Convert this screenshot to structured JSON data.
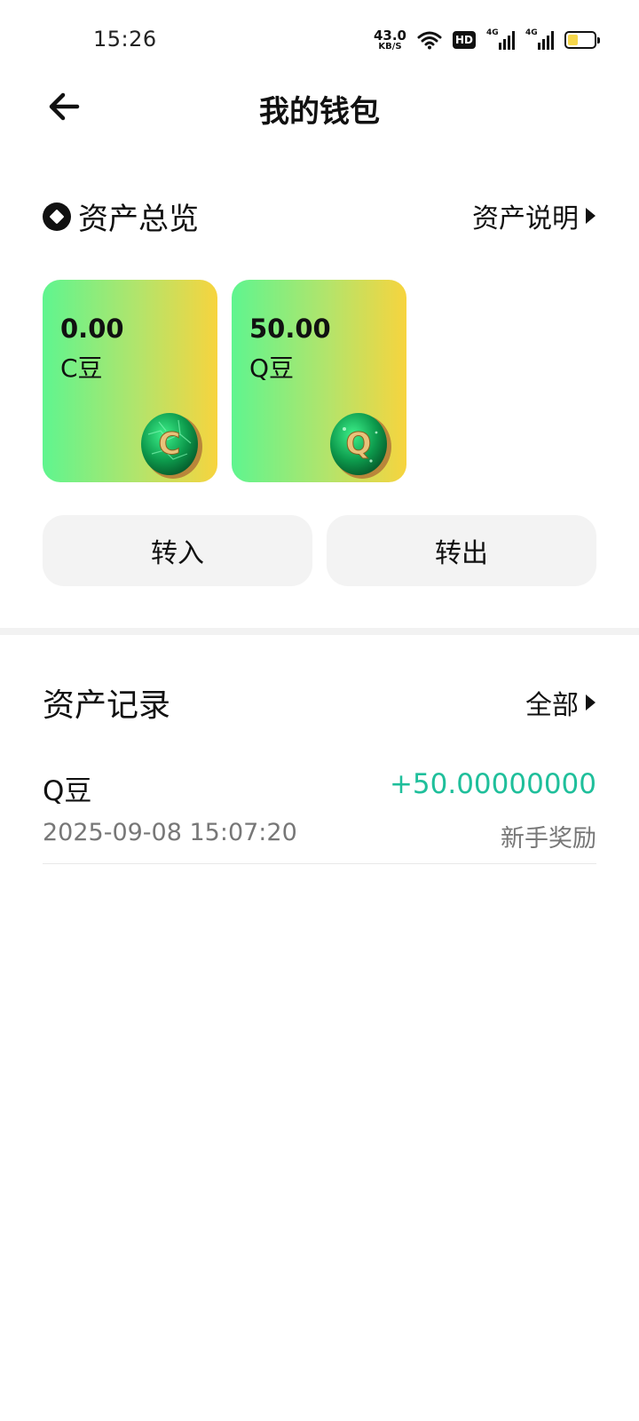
{
  "status_bar": {
    "time": "15:26",
    "net_speed_value": "43.0",
    "net_speed_unit": "KB/S",
    "hd_label": "HD",
    "sim1_tag": "4G",
    "sim2_tag": "4G",
    "battery_level": 0.38,
    "battery_color": "#f5d64a"
  },
  "header": {
    "title": "我的钱包",
    "back_icon": "arrow-left-icon"
  },
  "overview": {
    "title": "资产总览",
    "desc_link": "资产说明",
    "cards": [
      {
        "amount": "0.00",
        "name": "C豆",
        "coin_letter": "C"
      },
      {
        "amount": "50.00",
        "name": "Q豆",
        "coin_letter": "Q"
      }
    ]
  },
  "actions": {
    "transfer_in": "转入",
    "transfer_out": "转出"
  },
  "records": {
    "title": "资产记录",
    "filter_link": "全部",
    "items": [
      {
        "name": "Q豆",
        "amount": "+50.00000000",
        "time": "2025-09-08 15:07:20",
        "type": "新手奖励"
      }
    ]
  },
  "colors": {
    "accent_positive": "#1fbf9b",
    "card_gradient_start": "#5ff58f",
    "card_gradient_end": "#f7d43e"
  }
}
